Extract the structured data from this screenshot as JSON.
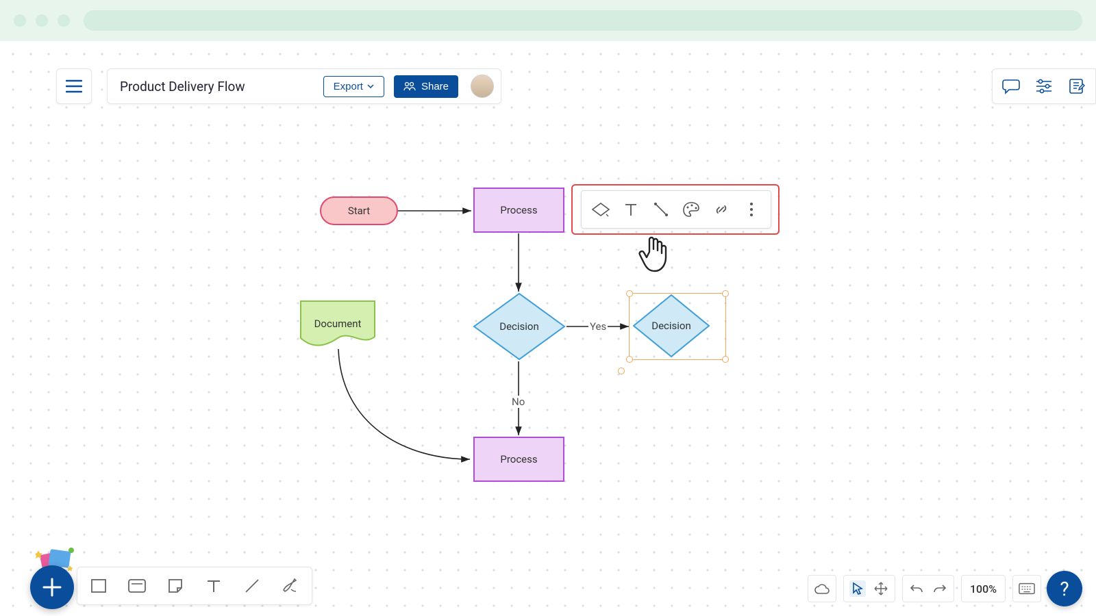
{
  "header": {
    "title": "Product Delivery Flow",
    "export_label": "Export",
    "share_label": "Share"
  },
  "nodes": {
    "start": "Start",
    "process1": "Process",
    "process2": "Process",
    "document": "Document",
    "decision1": "Decision",
    "decision2": "Decision"
  },
  "edges": {
    "yes": "Yes",
    "no": "No"
  },
  "zoom": "100%"
}
